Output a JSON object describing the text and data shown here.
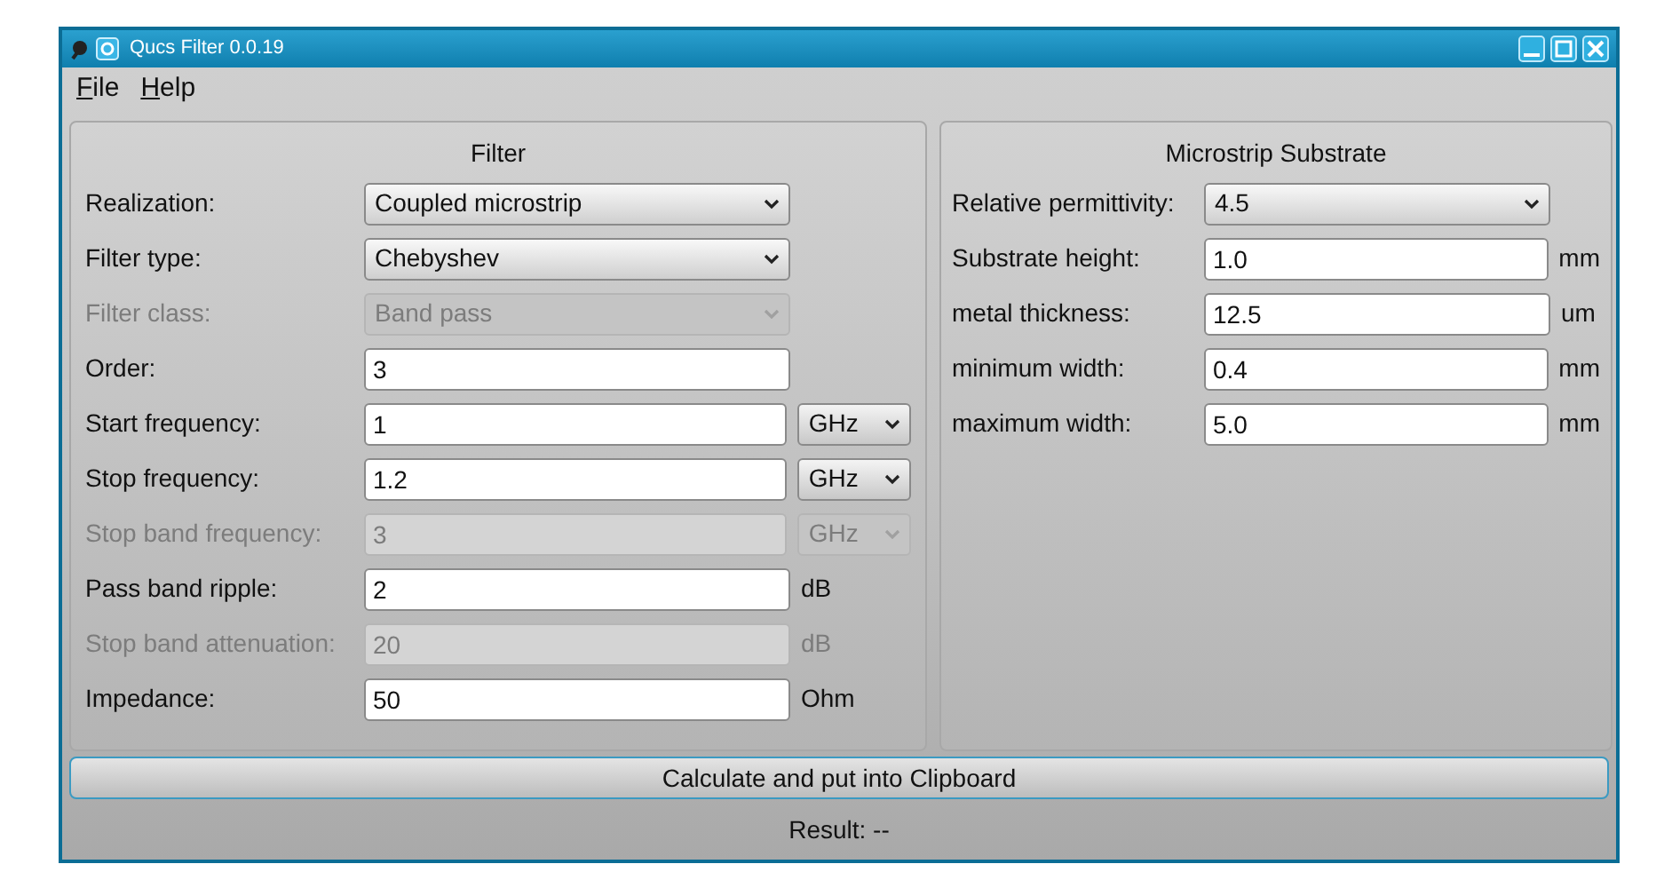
{
  "window": {
    "title": "Qucs Filter 0.0.19"
  },
  "menu": [
    {
      "label": "File"
    },
    {
      "label": "Help"
    }
  ],
  "filter": {
    "title": "Filter",
    "rows": [
      {
        "label": "Realization:",
        "kind": "combo",
        "value": "Coupled microstrip",
        "disabled": false
      },
      {
        "label": "Filter type:",
        "kind": "combo",
        "value": "Chebyshev",
        "disabled": false
      },
      {
        "label": "Filter class:",
        "kind": "combo",
        "value": "Band pass",
        "disabled": true
      },
      {
        "label": "Order:",
        "kind": "input",
        "value": "3",
        "disabled": false
      },
      {
        "label": "Start frequency:",
        "kind": "input",
        "value": "1",
        "disabled": false,
        "unit": {
          "kind": "combo",
          "text": "GHz"
        }
      },
      {
        "label": "Stop frequency:",
        "kind": "input",
        "value": "1.2",
        "disabled": false,
        "unit": {
          "kind": "combo",
          "text": "GHz"
        }
      },
      {
        "label": "Stop band frequency:",
        "kind": "input",
        "value": "3",
        "disabled": true,
        "unit": {
          "kind": "combo",
          "text": "GHz"
        }
      },
      {
        "label": "Pass band ripple:",
        "kind": "input",
        "value": "2",
        "disabled": false,
        "unit": {
          "kind": "text",
          "text": "dB"
        }
      },
      {
        "label": "Stop band attenuation:",
        "kind": "input",
        "value": "20",
        "disabled": true,
        "unit": {
          "kind": "text",
          "text": "dB"
        }
      },
      {
        "label": "Impedance:",
        "kind": "input",
        "value": "50",
        "disabled": false,
        "unit": {
          "kind": "text",
          "text": "Ohm"
        }
      }
    ]
  },
  "substrate": {
    "title": "Microstrip Substrate",
    "rows": [
      {
        "label": "Relative permittivity:",
        "kind": "combo",
        "value": "4.5",
        "disabled": false
      },
      {
        "label": "Substrate height:",
        "kind": "input",
        "value": "1.0",
        "disabled": false,
        "unit": {
          "kind": "text",
          "text": "mm"
        }
      },
      {
        "label": "metal thickness:",
        "kind": "input",
        "value": "12.5",
        "disabled": false,
        "unit": {
          "kind": "text",
          "text": "um"
        }
      },
      {
        "label": "minimum width:",
        "kind": "input",
        "value": "0.4",
        "disabled": false,
        "unit": {
          "kind": "text",
          "text": "mm"
        }
      },
      {
        "label": "maximum width:",
        "kind": "input",
        "value": "5.0",
        "disabled": false,
        "unit": {
          "kind": "text",
          "text": "mm"
        }
      }
    ]
  },
  "calculate_button": "Calculate and put into Clipboard",
  "result": "Result: --"
}
